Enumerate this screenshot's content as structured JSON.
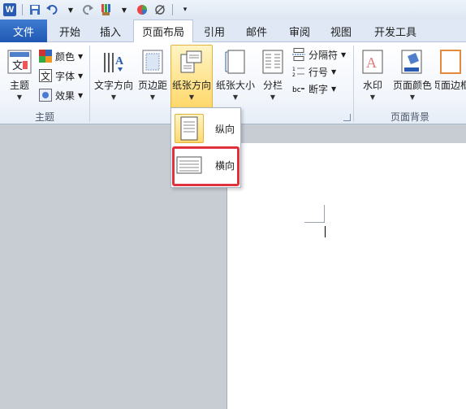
{
  "app": {
    "logo_letter": "W"
  },
  "quick_access": {
    "items": [
      "save-icon",
      "undo-icon",
      "redo-icon",
      "format-painter-icon",
      "color-icon",
      "erase-icon",
      "customize-icon"
    ]
  },
  "tabs": [
    "文件",
    "开始",
    "插入",
    "页面布局",
    "引用",
    "邮件",
    "审阅",
    "视图",
    "开发工具"
  ],
  "active_tab": "页面布局",
  "ribbon": {
    "themes_group": {
      "label": "主题",
      "theme_button": "主题",
      "colors": "颜色",
      "fonts": "字体",
      "effects": "效果"
    },
    "page_setup_group": {
      "text_direction": "文字方向",
      "margins": "页边距",
      "orientation": "纸张方向",
      "size": "纸张大小",
      "columns": "分栏",
      "breaks": "分隔符",
      "line_numbers": "行号",
      "hyphenation": "断字"
    },
    "background_group": {
      "label": "页面背景",
      "watermark": "水印",
      "page_color": "页面颜色",
      "page_borders": "页面边框"
    }
  },
  "orientation_menu": {
    "items": [
      {
        "label": "纵向",
        "selected": true
      },
      {
        "label": "横向",
        "selected": false
      }
    ]
  },
  "colors": {
    "highlight": "#ffd86b",
    "file_tab": "#1f58b3",
    "callout": "#e0323c"
  }
}
